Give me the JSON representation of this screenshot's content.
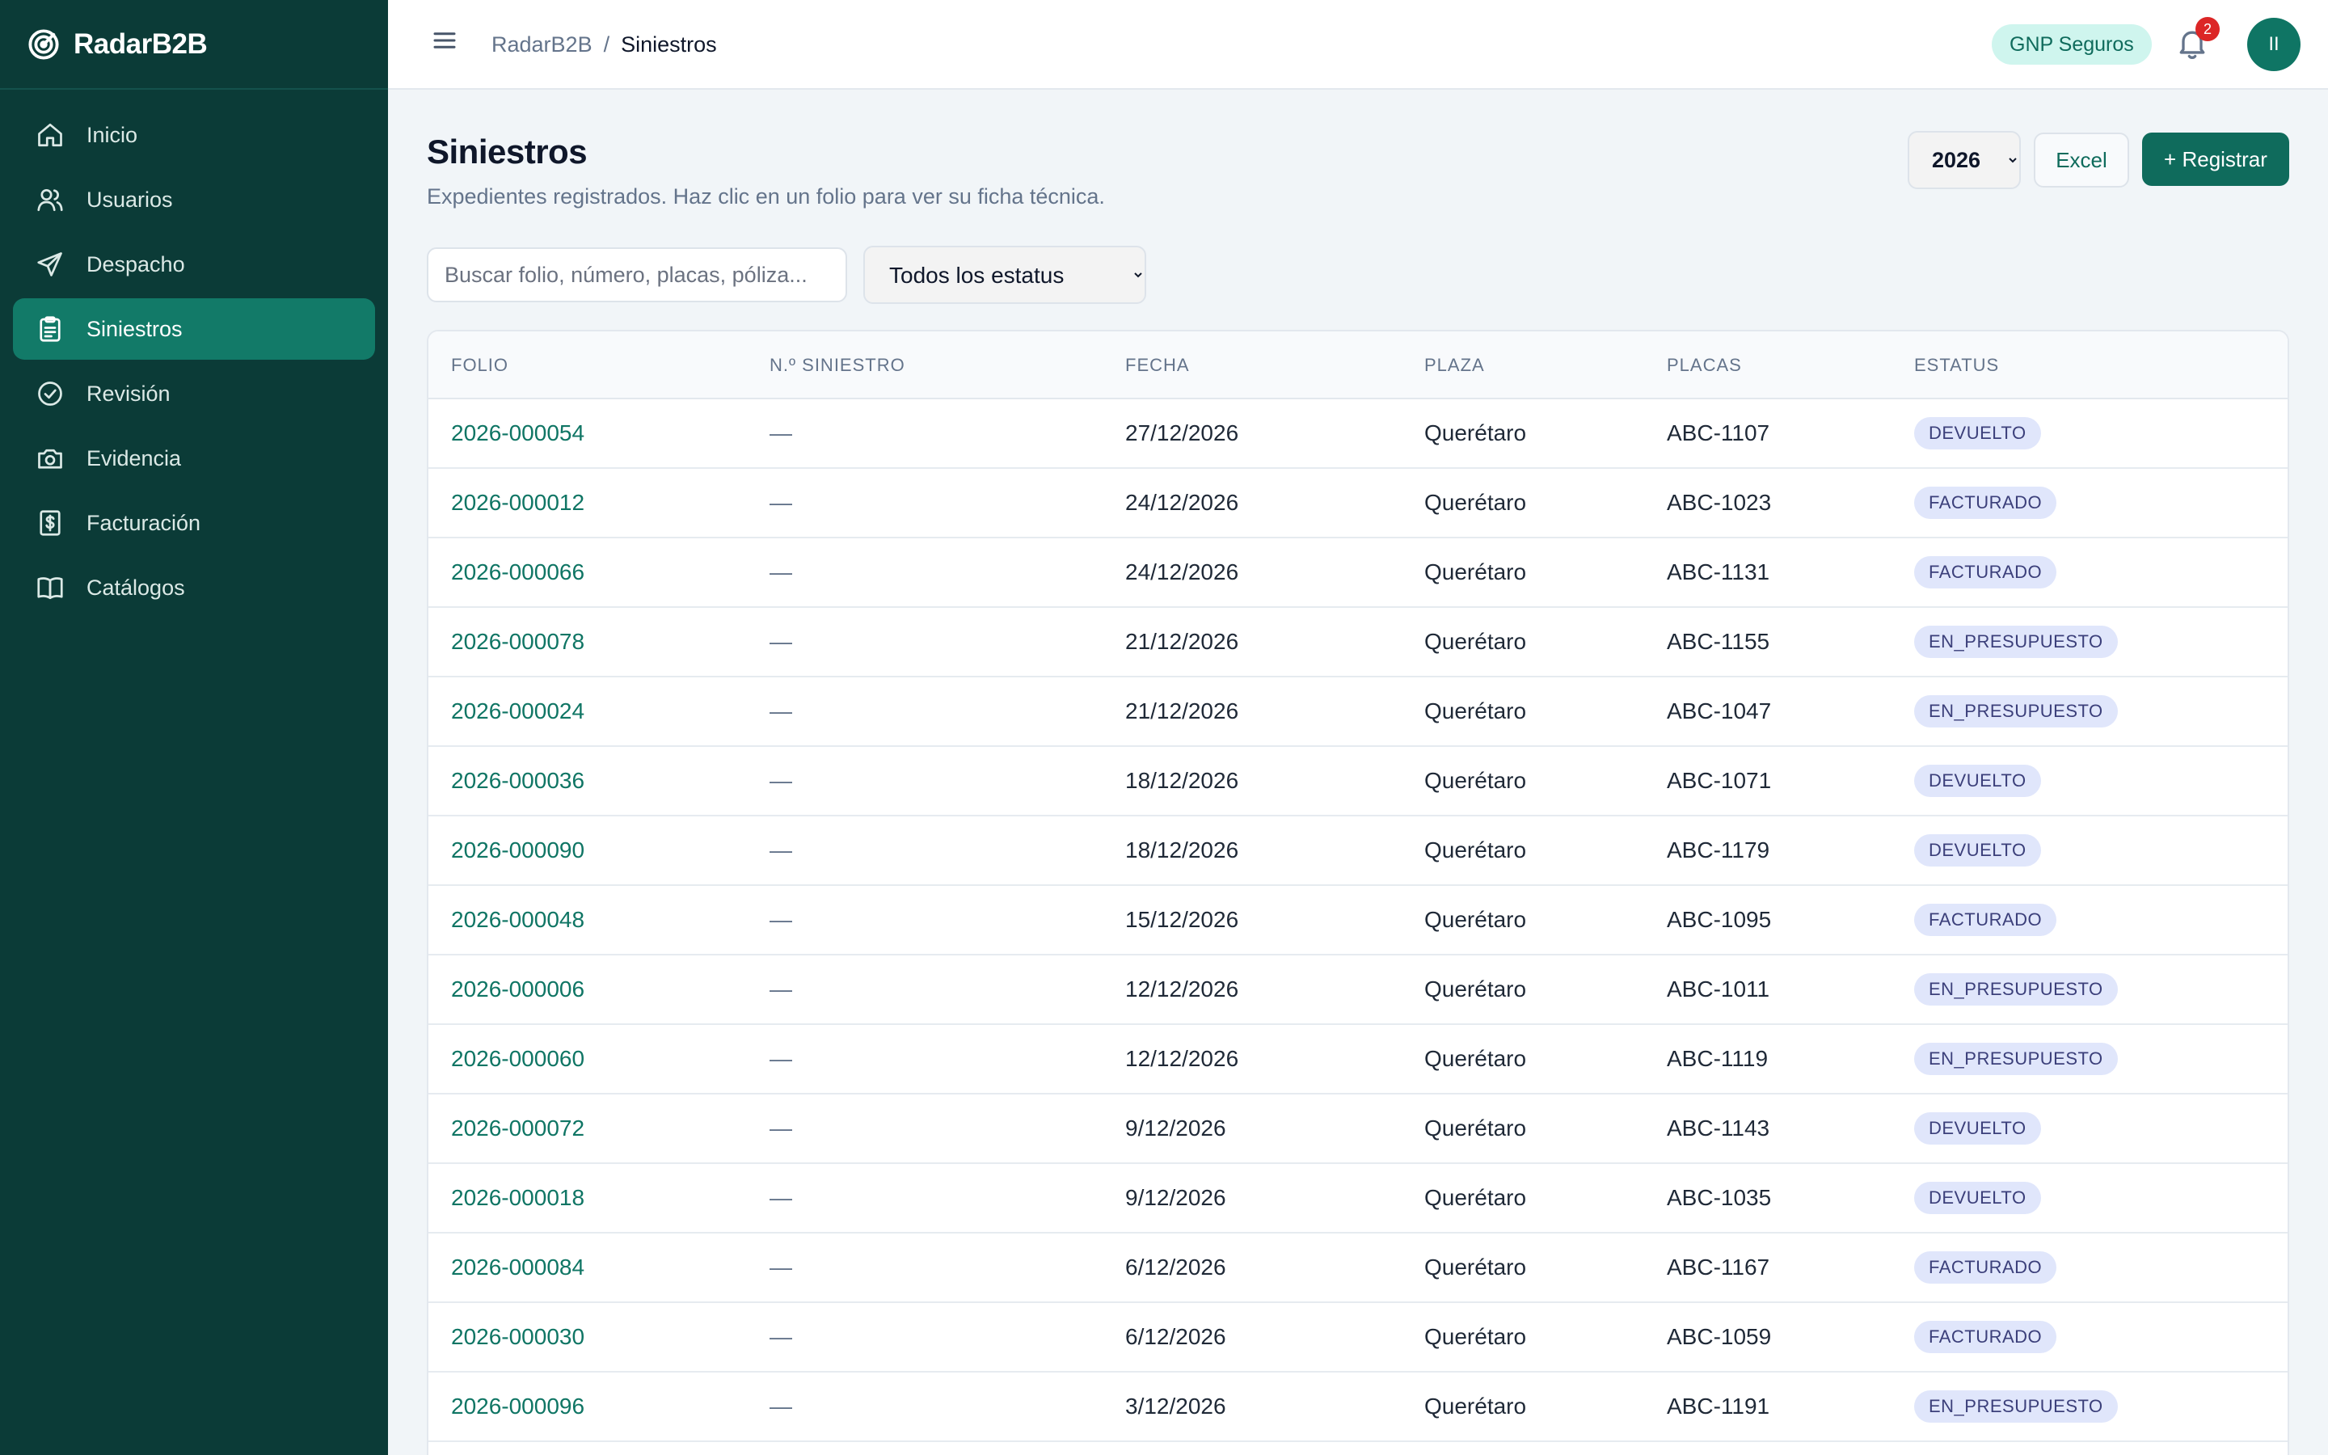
{
  "sidebar": {
    "brand": "RadarB2B",
    "items": [
      {
        "label": "Inicio",
        "icon": "home-icon"
      },
      {
        "label": "Usuarios",
        "icon": "users-icon"
      },
      {
        "label": "Despacho",
        "icon": "send-icon"
      },
      {
        "label": "Siniestros",
        "icon": "clipboard-icon",
        "active": true
      },
      {
        "label": "Revisión",
        "icon": "check-circle-icon"
      },
      {
        "label": "Evidencia",
        "icon": "camera-icon"
      },
      {
        "label": "Facturación",
        "icon": "dollar-receipt-icon"
      },
      {
        "label": "Catálogos",
        "icon": "book-icon"
      }
    ]
  },
  "header": {
    "breadcrumb_root": "RadarB2B",
    "breadcrumb_sep": "/",
    "breadcrumb_current": "Siniestros",
    "company": "GNP Seguros",
    "notifications": "2",
    "avatar_initials": "II"
  },
  "main": {
    "title": "Siniestros",
    "subtitle": "Expedientes registrados. Haz clic en un folio para ver su ficha técnica.",
    "year": "2026",
    "excel_label": "Excel",
    "register_label": "+ Registrar",
    "search_placeholder": "Buscar folio, número, placas, póliza...",
    "status_filter": "Todos los estatus"
  },
  "table": {
    "columns": [
      "FOLIO",
      "N.º SINIESTRO",
      "FECHA",
      "PLAZA",
      "PLACAS",
      "ESTATUS"
    ],
    "rows": [
      {
        "folio": "2026-000054",
        "numero": "—",
        "fecha": "27/12/2026",
        "plaza": "Querétaro",
        "placas": "ABC-1107",
        "estatus": "DEVUELTO"
      },
      {
        "folio": "2026-000012",
        "numero": "—",
        "fecha": "24/12/2026",
        "plaza": "Querétaro",
        "placas": "ABC-1023",
        "estatus": "FACTURADO"
      },
      {
        "folio": "2026-000066",
        "numero": "—",
        "fecha": "24/12/2026",
        "plaza": "Querétaro",
        "placas": "ABC-1131",
        "estatus": "FACTURADO"
      },
      {
        "folio": "2026-000078",
        "numero": "—",
        "fecha": "21/12/2026",
        "plaza": "Querétaro",
        "placas": "ABC-1155",
        "estatus": "EN_PRESUPUESTO"
      },
      {
        "folio": "2026-000024",
        "numero": "—",
        "fecha": "21/12/2026",
        "plaza": "Querétaro",
        "placas": "ABC-1047",
        "estatus": "EN_PRESUPUESTO"
      },
      {
        "folio": "2026-000036",
        "numero": "—",
        "fecha": "18/12/2026",
        "plaza": "Querétaro",
        "placas": "ABC-1071",
        "estatus": "DEVUELTO"
      },
      {
        "folio": "2026-000090",
        "numero": "—",
        "fecha": "18/12/2026",
        "plaza": "Querétaro",
        "placas": "ABC-1179",
        "estatus": "DEVUELTO"
      },
      {
        "folio": "2026-000048",
        "numero": "—",
        "fecha": "15/12/2026",
        "plaza": "Querétaro",
        "placas": "ABC-1095",
        "estatus": "FACTURADO"
      },
      {
        "folio": "2026-000006",
        "numero": "—",
        "fecha": "12/12/2026",
        "plaza": "Querétaro",
        "placas": "ABC-1011",
        "estatus": "EN_PRESUPUESTO"
      },
      {
        "folio": "2026-000060",
        "numero": "—",
        "fecha": "12/12/2026",
        "plaza": "Querétaro",
        "placas": "ABC-1119",
        "estatus": "EN_PRESUPUESTO"
      },
      {
        "folio": "2026-000072",
        "numero": "—",
        "fecha": "9/12/2026",
        "plaza": "Querétaro",
        "placas": "ABC-1143",
        "estatus": "DEVUELTO"
      },
      {
        "folio": "2026-000018",
        "numero": "—",
        "fecha": "9/12/2026",
        "plaza": "Querétaro",
        "placas": "ABC-1035",
        "estatus": "DEVUELTO"
      },
      {
        "folio": "2026-000084",
        "numero": "—",
        "fecha": "6/12/2026",
        "plaza": "Querétaro",
        "placas": "ABC-1167",
        "estatus": "FACTURADO"
      },
      {
        "folio": "2026-000030",
        "numero": "—",
        "fecha": "6/12/2026",
        "plaza": "Querétaro",
        "placas": "ABC-1059",
        "estatus": "FACTURADO"
      },
      {
        "folio": "2026-000096",
        "numero": "—",
        "fecha": "3/12/2026",
        "plaza": "Querétaro",
        "placas": "ABC-1191",
        "estatus": "EN_PRESUPUESTO"
      }
    ]
  },
  "colors": {
    "sidebar_bg": "#0b3b37",
    "sidebar_active": "#127a68",
    "accent": "#0f6b5c",
    "link": "#0f7564",
    "badge_bg": "#e0e6fb",
    "notification": "#dc2626"
  }
}
